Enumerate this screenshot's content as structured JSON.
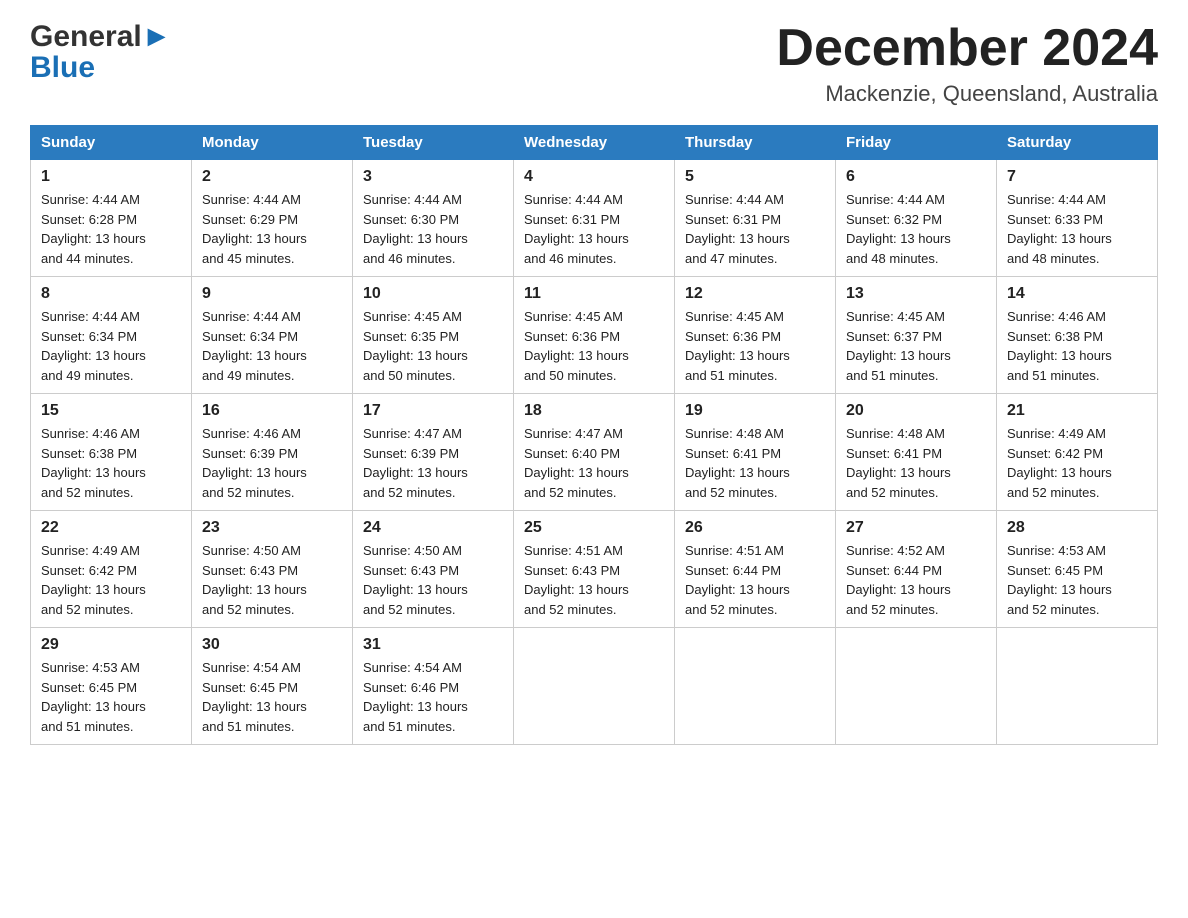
{
  "header": {
    "logo_line1": "General",
    "logo_line2": "Blue",
    "month_year": "December 2024",
    "location": "Mackenzie, Queensland, Australia"
  },
  "days_of_week": [
    "Sunday",
    "Monday",
    "Tuesday",
    "Wednesday",
    "Thursday",
    "Friday",
    "Saturday"
  ],
  "weeks": [
    [
      {
        "day": "1",
        "sunrise": "4:44 AM",
        "sunset": "6:28 PM",
        "daylight": "13 hours and 44 minutes."
      },
      {
        "day": "2",
        "sunrise": "4:44 AM",
        "sunset": "6:29 PM",
        "daylight": "13 hours and 45 minutes."
      },
      {
        "day": "3",
        "sunrise": "4:44 AM",
        "sunset": "6:30 PM",
        "daylight": "13 hours and 46 minutes."
      },
      {
        "day": "4",
        "sunrise": "4:44 AM",
        "sunset": "6:31 PM",
        "daylight": "13 hours and 46 minutes."
      },
      {
        "day": "5",
        "sunrise": "4:44 AM",
        "sunset": "6:31 PM",
        "daylight": "13 hours and 47 minutes."
      },
      {
        "day": "6",
        "sunrise": "4:44 AM",
        "sunset": "6:32 PM",
        "daylight": "13 hours and 48 minutes."
      },
      {
        "day": "7",
        "sunrise": "4:44 AM",
        "sunset": "6:33 PM",
        "daylight": "13 hours and 48 minutes."
      }
    ],
    [
      {
        "day": "8",
        "sunrise": "4:44 AM",
        "sunset": "6:34 PM",
        "daylight": "13 hours and 49 minutes."
      },
      {
        "day": "9",
        "sunrise": "4:44 AM",
        "sunset": "6:34 PM",
        "daylight": "13 hours and 49 minutes."
      },
      {
        "day": "10",
        "sunrise": "4:45 AM",
        "sunset": "6:35 PM",
        "daylight": "13 hours and 50 minutes."
      },
      {
        "day": "11",
        "sunrise": "4:45 AM",
        "sunset": "6:36 PM",
        "daylight": "13 hours and 50 minutes."
      },
      {
        "day": "12",
        "sunrise": "4:45 AM",
        "sunset": "6:36 PM",
        "daylight": "13 hours and 51 minutes."
      },
      {
        "day": "13",
        "sunrise": "4:45 AM",
        "sunset": "6:37 PM",
        "daylight": "13 hours and 51 minutes."
      },
      {
        "day": "14",
        "sunrise": "4:46 AM",
        "sunset": "6:38 PM",
        "daylight": "13 hours and 51 minutes."
      }
    ],
    [
      {
        "day": "15",
        "sunrise": "4:46 AM",
        "sunset": "6:38 PM",
        "daylight": "13 hours and 52 minutes."
      },
      {
        "day": "16",
        "sunrise": "4:46 AM",
        "sunset": "6:39 PM",
        "daylight": "13 hours and 52 minutes."
      },
      {
        "day": "17",
        "sunrise": "4:47 AM",
        "sunset": "6:39 PM",
        "daylight": "13 hours and 52 minutes."
      },
      {
        "day": "18",
        "sunrise": "4:47 AM",
        "sunset": "6:40 PM",
        "daylight": "13 hours and 52 minutes."
      },
      {
        "day": "19",
        "sunrise": "4:48 AM",
        "sunset": "6:41 PM",
        "daylight": "13 hours and 52 minutes."
      },
      {
        "day": "20",
        "sunrise": "4:48 AM",
        "sunset": "6:41 PM",
        "daylight": "13 hours and 52 minutes."
      },
      {
        "day": "21",
        "sunrise": "4:49 AM",
        "sunset": "6:42 PM",
        "daylight": "13 hours and 52 minutes."
      }
    ],
    [
      {
        "day": "22",
        "sunrise": "4:49 AM",
        "sunset": "6:42 PM",
        "daylight": "13 hours and 52 minutes."
      },
      {
        "day": "23",
        "sunrise": "4:50 AM",
        "sunset": "6:43 PM",
        "daylight": "13 hours and 52 minutes."
      },
      {
        "day": "24",
        "sunrise": "4:50 AM",
        "sunset": "6:43 PM",
        "daylight": "13 hours and 52 minutes."
      },
      {
        "day": "25",
        "sunrise": "4:51 AM",
        "sunset": "6:43 PM",
        "daylight": "13 hours and 52 minutes."
      },
      {
        "day": "26",
        "sunrise": "4:51 AM",
        "sunset": "6:44 PM",
        "daylight": "13 hours and 52 minutes."
      },
      {
        "day": "27",
        "sunrise": "4:52 AM",
        "sunset": "6:44 PM",
        "daylight": "13 hours and 52 minutes."
      },
      {
        "day": "28",
        "sunrise": "4:53 AM",
        "sunset": "6:45 PM",
        "daylight": "13 hours and 52 minutes."
      }
    ],
    [
      {
        "day": "29",
        "sunrise": "4:53 AM",
        "sunset": "6:45 PM",
        "daylight": "13 hours and 51 minutes."
      },
      {
        "day": "30",
        "sunrise": "4:54 AM",
        "sunset": "6:45 PM",
        "daylight": "13 hours and 51 minutes."
      },
      {
        "day": "31",
        "sunrise": "4:54 AM",
        "sunset": "6:46 PM",
        "daylight": "13 hours and 51 minutes."
      },
      null,
      null,
      null,
      null
    ]
  ],
  "labels": {
    "sunrise": "Sunrise:",
    "sunset": "Sunset:",
    "daylight": "Daylight:"
  }
}
